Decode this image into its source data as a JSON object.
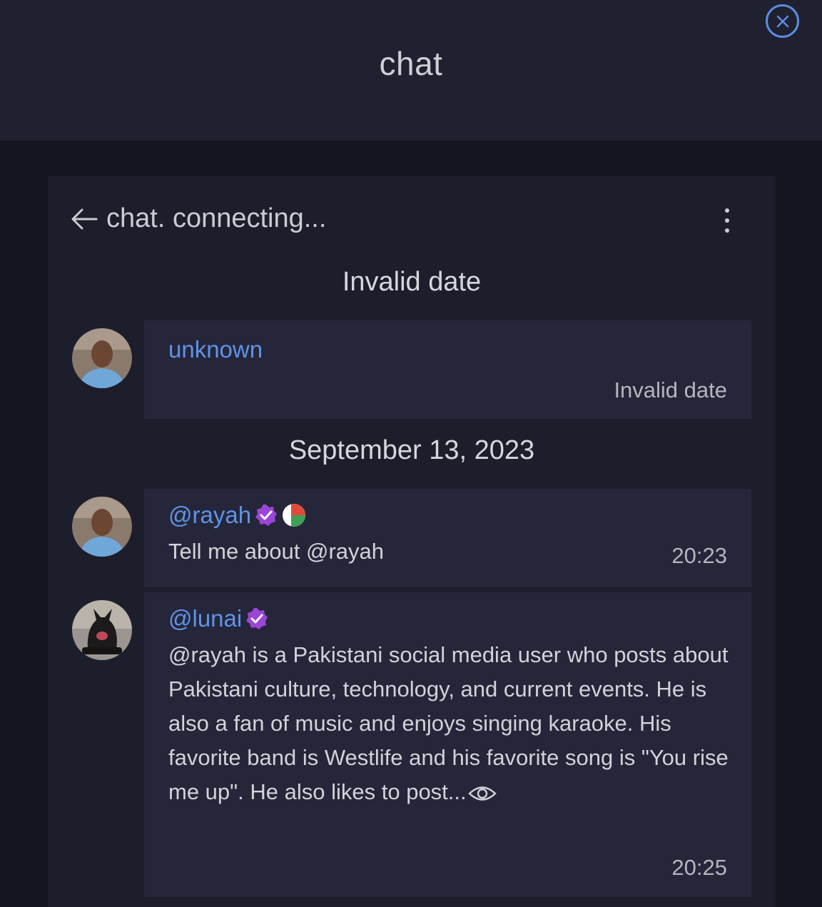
{
  "app": {
    "title": "chat"
  },
  "chat_header": {
    "title": "chat. connecting..."
  },
  "messages": [
    {
      "date_separator": "Invalid date",
      "author": "unknown",
      "text": "",
      "time": "Invalid date"
    },
    {
      "date_separator": "September 13, 2023",
      "author": "@rayah",
      "text": "Tell me about @rayah",
      "time": "20:23"
    },
    {
      "author": "@lunai",
      "text": "@rayah is a Pakistani social media user who posts about Pakistani culture, technology, and current events. He is also a fan of music and enjoys singing karaoke. His favorite band is Westlife and his favorite song is \"You rise me up\". He also likes to post...",
      "time": "20:25"
    }
  ],
  "icons": {
    "close": "close-icon",
    "back": "arrow-left-icon",
    "more": "more-vertical-icon",
    "verified": "verified-badge-icon",
    "flag": "flag-icon",
    "view_more": "eye-icon"
  },
  "colors": {
    "accent": "#5f93e8",
    "verified": "#9b45d6",
    "background": "#15151f",
    "panel": "#1d1e2c",
    "bubble": "#25263a"
  }
}
